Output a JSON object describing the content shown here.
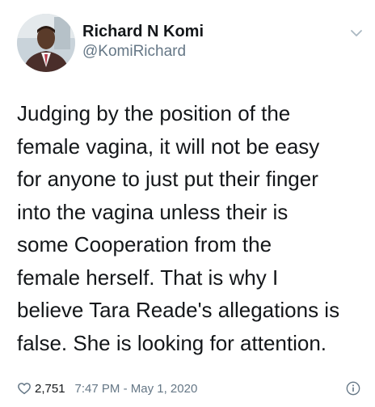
{
  "tweet": {
    "author": {
      "display_name": "Richard N Komi",
      "handle": "@KomiRichard",
      "avatar_icon": "profile-photo"
    },
    "text": "Judging by the position of the\nfemale vagina, it will not be easy\nfor anyone to just put their finger\ninto the vagina unless their is\nsome Cooperation from the\nfemale herself. That is why I\nbelieve Tara Reade's allegations is\nfalse. She is looking for attention.",
    "likes": "2,751",
    "timestamp": "7:47 PM - May 1, 2020",
    "icons": {
      "caret": "chevron-down-icon",
      "like": "heart-icon",
      "info": "info-icon"
    }
  },
  "colors": {
    "text_primary": "#14171a",
    "text_secondary": "#657786",
    "caret": "#aab8c2",
    "background": "#ffffff"
  }
}
